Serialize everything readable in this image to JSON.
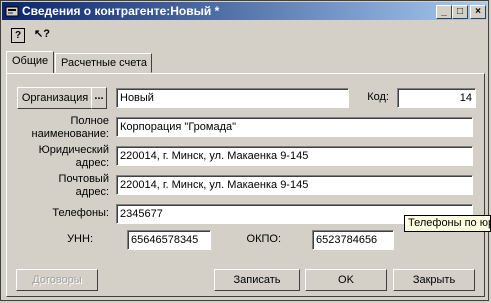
{
  "window": {
    "title": "Сведения о контрагенте:Новый *"
  },
  "title_buttons": {
    "minimize": "_",
    "maximize": "□",
    "close": "×"
  },
  "toolbar": {
    "help_icon": "?",
    "whatsthis_icon": "↖?"
  },
  "tabs": [
    {
      "label": "Общие"
    },
    {
      "label": "Расчетные счета"
    }
  ],
  "form": {
    "org_button_label": "Организация",
    "org_picker_label": "...",
    "type_value": "Новый",
    "code_label": "Код:",
    "code_value": "14",
    "fullname_label_1": "Полное",
    "fullname_label_2": "наименование:",
    "fullname_value": "Корпорация \"Громада\"",
    "legal_addr_label_1": "Юридический",
    "legal_addr_label_2": "адрес:",
    "legal_addr_value": "220014, г. Минск, ул. Макаенка 9-145",
    "postal_addr_label_1": "Почтовый",
    "postal_addr_label_2": "адрес:",
    "postal_addr_value": "220014, г. Минск, ул. Макаенка 9-145",
    "phones_label": "Телефоны:",
    "phones_value": "2345677",
    "unn_label": "УНН:",
    "unn_value": "65646578345",
    "okpo_label": "ОКПО:",
    "okpo_value": "6523784656"
  },
  "tooltip": {
    "text": "Телефоны по юр"
  },
  "buttons": {
    "contracts": "Договоры",
    "save": "Записать",
    "ok": "OK",
    "close": "Закрыть"
  }
}
